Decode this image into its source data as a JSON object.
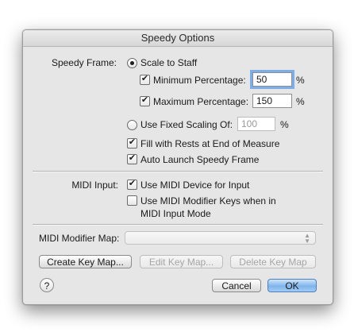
{
  "window": {
    "title": "Speedy Options"
  },
  "speedy_frame": {
    "label": "Speedy Frame:",
    "scale_to_staff": {
      "label": "Scale to Staff",
      "selected": true
    },
    "min_percentage": {
      "label": "Minimum Percentage:",
      "value": "50",
      "unit": "%",
      "checked": true
    },
    "max_percentage": {
      "label": "Maximum Percentage:",
      "value": "150",
      "unit": "%",
      "checked": true
    },
    "fixed_scaling": {
      "label": "Use Fixed Scaling Of:",
      "value": "100",
      "unit": "%",
      "selected": false
    },
    "fill_rests": {
      "label": "Fill with Rests at End of Measure",
      "checked": true
    },
    "auto_launch": {
      "label": "Auto Launch Speedy Frame",
      "checked": true
    }
  },
  "midi_input": {
    "label": "MIDI Input:",
    "use_device": {
      "label": "Use MIDI Device for Input",
      "checked": true
    },
    "modifier_keys": {
      "label_line1": "Use MIDI Modifier Keys when in",
      "label_line2": "MIDI Input Mode",
      "checked": false
    }
  },
  "modifier_map": {
    "label": "MIDI Modifier Map:",
    "value": ""
  },
  "buttons": {
    "create_key_map": "Create Key Map...",
    "edit_key_map": "Edit Key Map...",
    "delete_key_map": "Delete Key Map",
    "cancel": "Cancel",
    "ok": "OK",
    "help": "?"
  },
  "colors": {
    "default_button": "#7fb4ec",
    "focus_ring": "#7eaee9"
  }
}
